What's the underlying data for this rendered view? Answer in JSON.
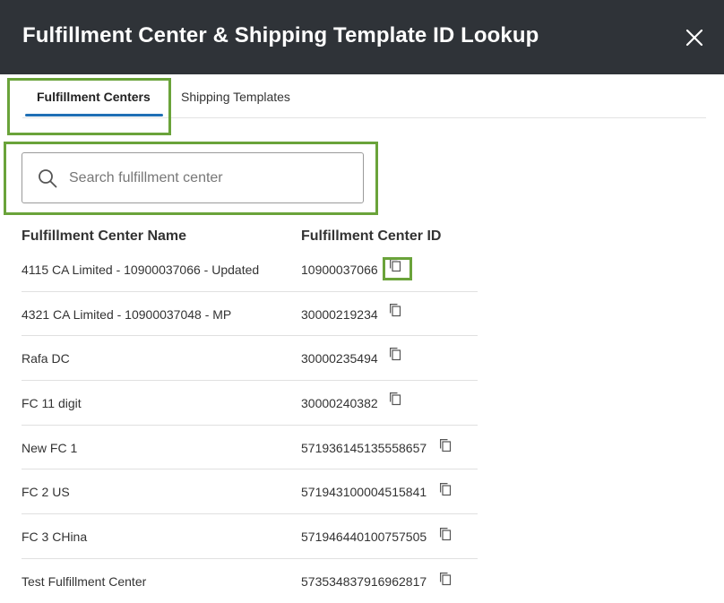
{
  "dialog": {
    "title": "Fulfillment Center & Shipping Template ID Lookup",
    "close_icon": "close-icon"
  },
  "tabs": [
    {
      "label": "Fulfillment Centers",
      "active": true
    },
    {
      "label": "Shipping Templates",
      "active": false
    }
  ],
  "search": {
    "placeholder": "Search fulfillment center",
    "value": ""
  },
  "table": {
    "columns": [
      "Fulfillment Center Name",
      "Fulfillment Center ID"
    ],
    "rows": [
      {
        "name": "4115 CA Limited - 10900037066 - Updated",
        "id": "10900037066"
      },
      {
        "name": "4321 CA Limited - 10900037048 - MP",
        "id": "30000219234"
      },
      {
        "name": "Rafa DC",
        "id": "30000235494"
      },
      {
        "name": "FC 11 digit",
        "id": "30000240382"
      },
      {
        "name": "New FC 1",
        "id": "571936145135558657"
      },
      {
        "name": "FC 2 US",
        "id": "571943100004515841"
      },
      {
        "name": "FC 3 CHina",
        "id": "571946440100757505"
      },
      {
        "name": "Test Fulfillment Center",
        "id": "573534837916962817"
      }
    ]
  },
  "colors": {
    "header_bg": "#2f3338",
    "highlight": "#6aa33a",
    "tab_accent": "#1f6fb5"
  }
}
